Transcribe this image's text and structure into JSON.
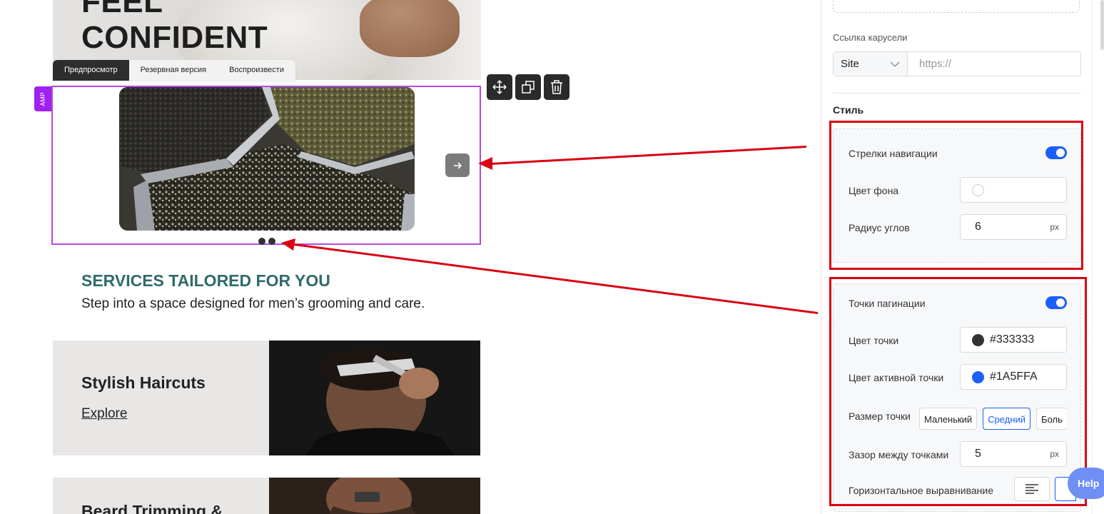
{
  "hero": {
    "line1": "FEEL",
    "line2": "CONFIDENT"
  },
  "tabs": [
    "Предпросмотр",
    "Резервная версия",
    "Воспроизвести"
  ],
  "amp_badge": "AMP",
  "services": {
    "title": "SERVICES TAILORED FOR YOU",
    "subtitle": "Step into a space designed for men’s grooming and care."
  },
  "cards": [
    {
      "title": "Stylish Haircuts",
      "link": "Explore"
    },
    {
      "title": "Beard Trimming &"
    }
  ],
  "carousel": {
    "dots": 2
  },
  "panel": {
    "link_label": "Ссылка карусели",
    "link_select": "Site",
    "link_placeholder": "https://",
    "style_heading": "Стиль",
    "nav_arrows": "Стрелки навигации",
    "bg_color": "Цвет фона",
    "corner_radius": "Радиус углов",
    "corner_radius_value": "6",
    "unit_px": "px",
    "pagination_dots": "Точки пагинации",
    "dot_color": "Цвет точки",
    "dot_color_value": "#333333",
    "active_dot_color": "Цвет активной точки",
    "active_dot_color_value": "#1A5FFA",
    "dot_size": "Размер точки",
    "dot_size_options": [
      "Маленький",
      "Средний",
      "Боль"
    ],
    "dot_gap": "Зазор между точками",
    "dot_gap_value": "5",
    "horizontal_align": "Горизонтальное выравнивание"
  },
  "help_label": "Help",
  "colors": {
    "accent": "#1A5FFA",
    "dot": "#333333",
    "amp": "#A020F0",
    "annotation": "#D90012",
    "heading": "#2F6B6B"
  }
}
